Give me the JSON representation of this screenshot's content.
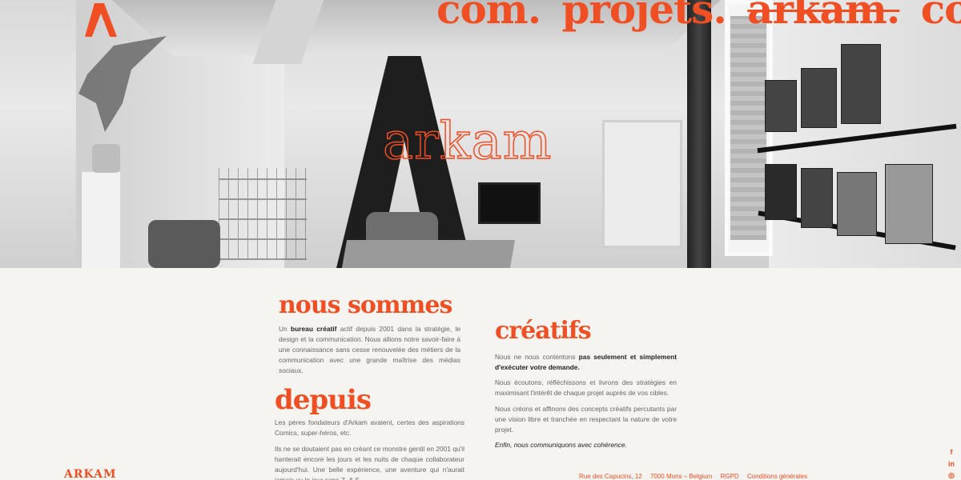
{
  "nav": {
    "items": [
      {
        "label": "com."
      },
      {
        "label": "projets."
      },
      {
        "label": "arkam."
      },
      {
        "label": "contact."
      }
    ]
  },
  "hero": {
    "title": "arkam"
  },
  "sections": {
    "nous_sommes": {
      "heading": "nous sommes",
      "p1_a": "Un ",
      "p1_b": "bureau créatif",
      "p1_c": " actif depuis 2001 dans la stratégie, le design et la communication. Nous allions notre savoir-faire à une connaissance sans cesse renouvelée des métiers de la communication avec une grande maîtrise des médias sociaux."
    },
    "creatifs": {
      "heading": "créatifs",
      "p1_a": "Nous ne nous contentons ",
      "p1_b": "pas seulement et simplement d'exécuter votre demande.",
      "p2": "Nous écoutons, réfléchissons et livrons des stratégies en maximisant l'intérêt de chaque projet auprès de vos cibles.",
      "p3": "Nous créons et affinons des concepts créatifs percutants par une vision libre et tranchée en respectant la nature de votre projet.",
      "p4": "Enfin, nous communiquons avec cohérence."
    },
    "depuis": {
      "heading": "depuis",
      "p1": "Les pères fondateurs d'Arkam avaient, certes des aspirations Comics, super-héros, etc.",
      "p2": "Ils ne se doutaient pas en créant ce monstre gentil en 2001 qu'il hanterait encore les jours et les nuits de chaque collaborateur aujourd'hui. Une belle expérience, une aventure qui n'aurait jamais vu le jour sans Z. & S."
    }
  },
  "footer": {
    "logo": "ARKAM",
    "address": "Rue des Capucins, 12",
    "city": "7000 Mons – Belgium",
    "rgpd": "RGPD",
    "conditions": "Conditions générales"
  },
  "social": [
    {
      "icon": "facebook-icon",
      "glyph": "f"
    },
    {
      "icon": "linkedin-icon",
      "glyph": "in"
    },
    {
      "icon": "instagram-icon",
      "glyph": "◎"
    }
  ],
  "colors": {
    "accent": "#f04e23",
    "background": "#f6f4f0"
  }
}
